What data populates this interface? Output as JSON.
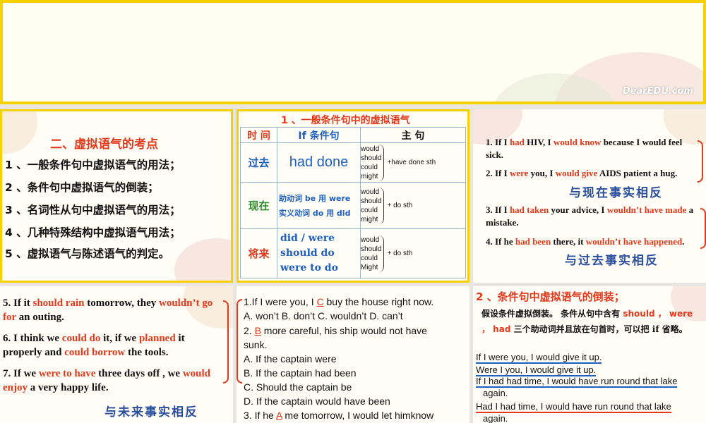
{
  "top_slide": {
    "watermark": "DearEDU.com"
  },
  "slide1": {
    "title": "二、虚拟语气的考点",
    "items": [
      "1 、一般条件句中虚拟语气的用法；",
      "2 、条件句中虚拟语气的倒装；",
      "3 、名词性从句中虚拟语气的用法；",
      "4 、几种特殊结构中虚拟语气用法；",
      "5 、虚拟语气与陈述语气的判定。"
    ]
  },
  "slide2": {
    "title": "1 、一般条件句中的虚拟语气",
    "headers": {
      "time": "时  间",
      "if": "If  条件句",
      "main": "主  句"
    },
    "rows": [
      {
        "time": "过去",
        "if_text": "had done",
        "modals": [
          "would",
          "should",
          "could",
          "might"
        ],
        "main": "+have done sth"
      },
      {
        "time": "现在",
        "if_line1": "助动词  be 用  were",
        "if_line2": "实义动词  do  用  did",
        "modals": [
          "would",
          "should",
          "could",
          "might"
        ],
        "main": "+ do sth"
      },
      {
        "time": "将来",
        "if_lines": [
          "did / were",
          "should do",
          "were to do"
        ],
        "modals": [
          "would",
          "should",
          "could",
          "Might"
        ],
        "main": "+ do sth"
      }
    ]
  },
  "slide3": {
    "s1": {
      "a": "1. If I ",
      "b": "had",
      "c": " HIV, I ",
      "d": "would know",
      "e": " because I would feel sick."
    },
    "s2": {
      "a": "2. If I ",
      "b": "were",
      "c": " you, I ",
      "d": "would give",
      "e": " AIDS patient a hug."
    },
    "note1": "与现在事实相反",
    "s3": {
      "a": "3. If I ",
      "b": "had taken",
      "c": " your advice, I ",
      "d": "wouldn’t have made",
      "e": " a mistake."
    },
    "s4": {
      "a": "4. If he ",
      "b": "had been",
      "c": " there, it ",
      "d": "wouldn’t have happened",
      "e": "."
    },
    "note2": "与过去事实相反"
  },
  "slide4": {
    "s1": {
      "a": "5. If it ",
      "b": "should rain",
      "c": " tomorrow, they ",
      "d": "wouldn’t go for",
      "e": " an outing."
    },
    "s2": {
      "a": "6. I think we ",
      "b": "could do",
      "c": " it, if we ",
      "d": "planned",
      "e": " it properly and ",
      "f": "could borrow",
      "g": " the tools."
    },
    "s3": {
      "a": "7. If we ",
      "b": "were to have",
      "c": " three days off , we ",
      "d": "would enjoy",
      "e": " a very happy life."
    },
    "note": "与未来事实相反"
  },
  "slide5": {
    "q1": {
      "a": "1.If I were you, I ",
      "ans": "C",
      "b": "   buy the house right now."
    },
    "q1_opts": "  A. won’t      B. don’t       C. wouldn’t   D. can’t",
    "q2": {
      "a": "2.  ",
      "ans": "B",
      "b": "    more careful, his ship would not have"
    },
    "q2_cont": "sunk.",
    "opts": [
      "A. If the captain were",
      "B. If the captain had been",
      "C. Should the captain be",
      "D. If the captain would have been"
    ],
    "q3": {
      "a": "3. If he ",
      "ans": "A",
      "b": "    me tomorrow, I would let himknow"
    }
  },
  "slide6": {
    "title": "2 、条件句中虚拟语气的倒装；",
    "desc_a": "假设条件虚拟倒装。 条件从句中含有 ",
    "desc_hl": "should ，  were ，   had",
    "desc_b": " 三个助动词并且放在句首时，可以把 if 省略。",
    "ex1": "If I were you, I would give it up.",
    "ex2": "Were I you, I would give it up.",
    "ex3a": "If I had had time, I would have run round that lake",
    "ex3b": "again.",
    "ex4a": "Had I had time, I would have run round that lake",
    "ex4b": "again."
  },
  "colors": {
    "accent_red": "#e2381b",
    "border_yellow": "#f7d000",
    "note_blue": "#2a4f9c"
  }
}
